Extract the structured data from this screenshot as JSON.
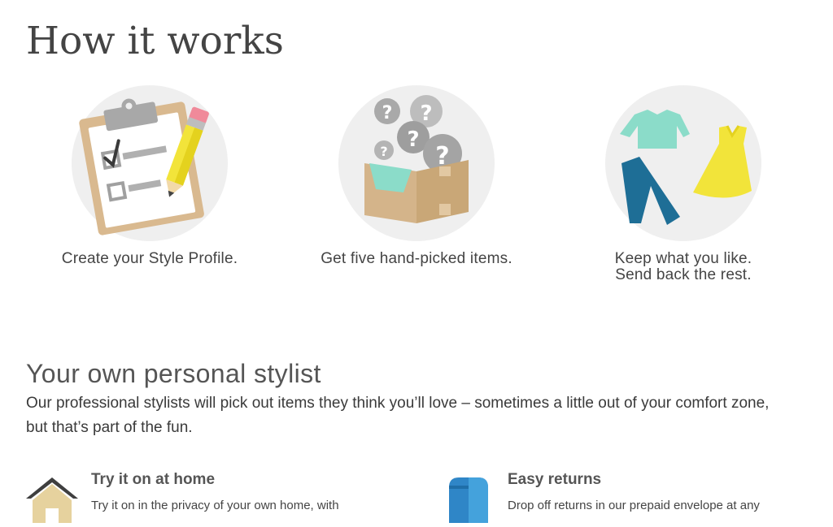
{
  "page": {
    "title": "How it works"
  },
  "steps": [
    {
      "icon": "clipboard-checklist-icon",
      "caption": "Create your Style Profile."
    },
    {
      "icon": "mystery-box-icon",
      "caption": "Get five hand-picked items."
    },
    {
      "icon": "clothing-items-icon",
      "caption_line1": "Keep what you like.",
      "caption_line2": "Send back the rest."
    }
  ],
  "stylist": {
    "heading": "Your own personal stylist",
    "description": "Our professional stylists will pick out items they think you’ll love – sometimes a little out of your comfort zone, but that’s part of the fun."
  },
  "features": [
    {
      "icon": "house-icon",
      "title": "Try it on at home",
      "text": "Try it on in the privacy of your own home, with"
    },
    {
      "icon": "mailbox-icon",
      "title": "Easy returns",
      "text": "Drop off returns in our prepaid envelope at any"
    }
  ],
  "colors": {
    "mint": "#8bdcc9",
    "teal": "#1e6e96",
    "yellow": "#f2e43a",
    "cardboard": "#d4b48a",
    "gray": "#9a9a9a"
  }
}
